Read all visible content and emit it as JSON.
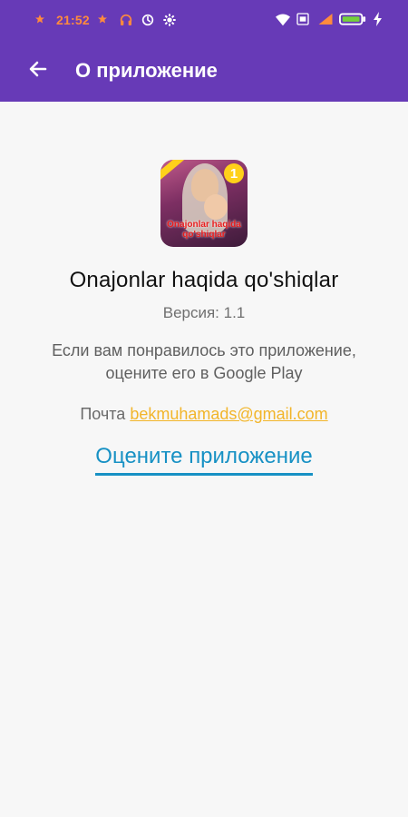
{
  "status": {
    "time": "21:52",
    "battery_color": "#74d13b"
  },
  "toolbar": {
    "title": "О приложение"
  },
  "about": {
    "app_icon_text": "Onajonlar haqida qo'shiqlar",
    "app_icon_badge": "1",
    "app_name": "Onajonlar haqida qo'shiqlar",
    "version": "Версия: 1.1",
    "rate_text": "Если вам понравилось это приложение, оцените его в Google Play",
    "mail_label": "Почта",
    "mail_address": "bekmuhamads@gmail.com",
    "rate_button": "Оцените приложение"
  },
  "colors": {
    "primary": "#673ab7",
    "link_blue": "#1791c4",
    "mail_orange": "#f2b52a"
  }
}
